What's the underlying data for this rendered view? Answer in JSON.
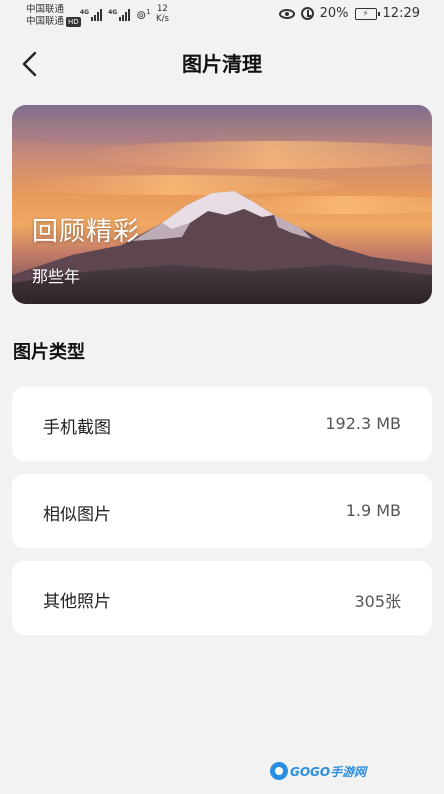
{
  "status_bar": {
    "carrier_1": "中国联通",
    "carrier_2": "中国联通",
    "hd_badge": "HD",
    "sig1_label": "4G",
    "sig2_label": "4G",
    "hotspot_sup": "1",
    "speed_value": "12",
    "speed_unit": "K/s",
    "battery_percent": "20%",
    "time": "12:29"
  },
  "header": {
    "title": "图片清理"
  },
  "banner": {
    "title": "回顾精彩",
    "subtitle": "那些年"
  },
  "section": {
    "title": "图片类型",
    "items": [
      {
        "label": "手机截图",
        "value": "192.3 MB"
      },
      {
        "label": "相似图片",
        "value": "1.9 MB"
      },
      {
        "label": "其他照片",
        "value": "305张"
      }
    ]
  },
  "watermark": {
    "text": "GOGO手游网"
  }
}
